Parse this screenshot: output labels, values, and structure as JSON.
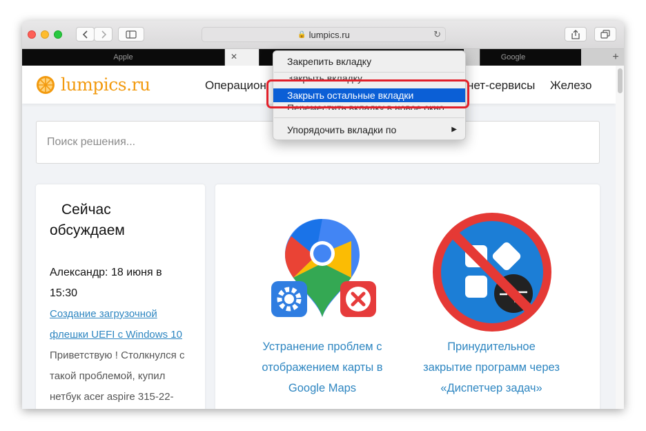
{
  "browser": {
    "url": "lumpics.ru",
    "tabs": [
      {
        "label": "Apple",
        "active": false
      },
      {
        "label": "",
        "active": true
      },
      {
        "label": "",
        "active": false
      },
      {
        "label": "Google",
        "active": false
      }
    ],
    "close_glyph": "✕",
    "new_tab_glyph": "+"
  },
  "site": {
    "logo_text": "lumpics.ru",
    "nav": [
      {
        "label": "Операцион"
      },
      {
        "label": "нет-сервисы"
      },
      {
        "label": "Железо"
      }
    ],
    "search_placeholder": "Поиск решения..."
  },
  "sidebar": {
    "title": "Сейчас обсуждаем",
    "comment_author": "Александр: 18 июня в 15:30",
    "comment_link": "Создание загрузочной флешки UEFI с Windows 10",
    "comment_text": "Приветствую ! Столкнулся с такой проблемой, купил нетбук acer aspire 315-22-"
  },
  "articles": [
    {
      "title": "Устранение проблем с отображением карты в Google Maps"
    },
    {
      "title": "Принудительное закрытие программ через «Диспетчер задач»"
    }
  ],
  "context_menu": {
    "items": [
      {
        "label": "Закрепить вкладку"
      },
      {
        "label": "Закрыть вкладку"
      },
      {
        "label": "Закрыть остальные вкладки",
        "highlighted": true
      },
      {
        "label": "Переместить вкладку в новое окно"
      },
      {
        "label": "Упорядочить вкладки по",
        "submenu_arrow": "▶"
      }
    ]
  },
  "colors": {
    "accent": "#2e86c1",
    "logo": "#f29a0f",
    "highlight": "#0b5fd6",
    "annotation": "#e2202a"
  },
  "icons": {
    "back": "chevron-left-icon",
    "forward": "chevron-right-icon",
    "sidebar": "sidebar-icon",
    "lock": "lock-icon",
    "reload": "reload-icon",
    "share": "share-icon",
    "tabs_overview": "tabs-overview-icon"
  }
}
